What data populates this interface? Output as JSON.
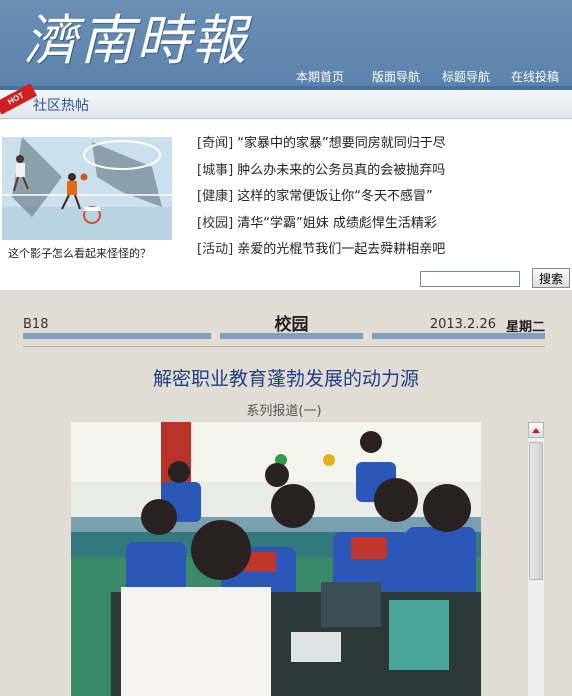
{
  "header": {
    "logo_text": "濟南時報",
    "nav": [
      {
        "label": "本期首页"
      },
      {
        "label": "版面导航"
      },
      {
        "label": "标题导航"
      },
      {
        "label": "在线投稿"
      }
    ]
  },
  "community": {
    "badge": "HOT",
    "title": "社区热帖",
    "photo_caption": "这个影子怎么看起来怪怪的？",
    "posts": [
      {
        "tag": "[奇闻]",
        "title": "“家暴中的家暴”想要同房就同归于尽"
      },
      {
        "tag": "[城事]",
        "title": "肿么办未来的公务员真的会被抛弃吗"
      },
      {
        "tag": "[健康]",
        "title": "这样的家常便饭让你“冬天不感冒”"
      },
      {
        "tag": "[校园]",
        "title": "清华“学霸”姐妹 成绩彪悍生活精彩"
      },
      {
        "tag": "[活动]",
        "title": "亲爱的光棍节我们一起去舜耕相亲吧"
      }
    ]
  },
  "search": {
    "input_value": "",
    "button_label": "搜索"
  },
  "page": {
    "number": "B18",
    "section": "校园",
    "date": "2013.2.26",
    "weekday": "星期二"
  },
  "article": {
    "headline": "解密职业教育蓬勃发展的动力源",
    "subhead": "系列报道(一)"
  },
  "colors": {
    "header_blue": "#6a8fb4",
    "headline_blue": "#1f3f86",
    "hot_red": "#d21e1e",
    "rule_blue": "#7e9fbd"
  }
}
